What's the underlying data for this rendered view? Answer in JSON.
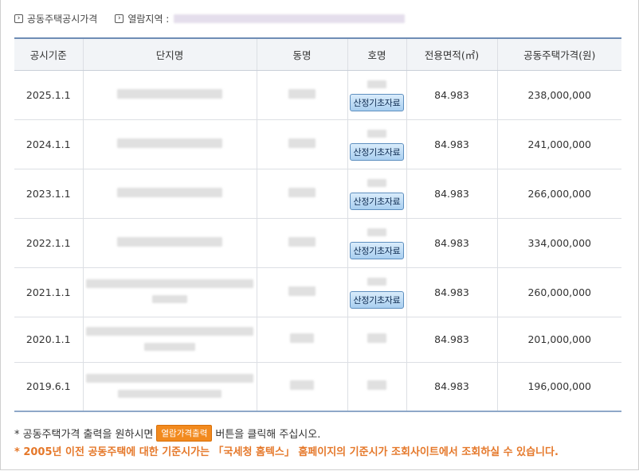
{
  "breadcrumbs": {
    "item1": "공동주택공시가격",
    "item2_label": "열람지역 :"
  },
  "table": {
    "headers": [
      "공시기준",
      "단지명",
      "동명",
      "호명",
      "전용면적(㎡)",
      "공동주택가격(원)"
    ],
    "calc_button_label": "산정기초자료",
    "rows": [
      {
        "date": "2025.1.1",
        "area": "84.983",
        "price": "238,000,000"
      },
      {
        "date": "2024.1.1",
        "area": "84.983",
        "price": "241,000,000"
      },
      {
        "date": "2023.1.1",
        "area": "84.983",
        "price": "266,000,000"
      },
      {
        "date": "2022.1.1",
        "area": "84.983",
        "price": "334,000,000"
      },
      {
        "date": "2021.1.1",
        "area": "84.983",
        "price": "260,000,000"
      },
      {
        "date": "2020.1.1",
        "area": "84.983",
        "price": "201,000,000"
      },
      {
        "date": "2019.6.1",
        "area": "84.983",
        "price": "196,000,000"
      }
    ]
  },
  "notes": {
    "line1_before": "* 공동주택가격 출력을 원하시면",
    "print_button_label": "열람가격출력",
    "line1_after": "버튼을 클릭해 주십시오.",
    "line2": "* 2005년 이전 공동주택에 대한 기준시가는 「국세청 홈텍스」 홈페이지의 기준시가 조회사이트에서 조회하실 수 있습니다."
  }
}
